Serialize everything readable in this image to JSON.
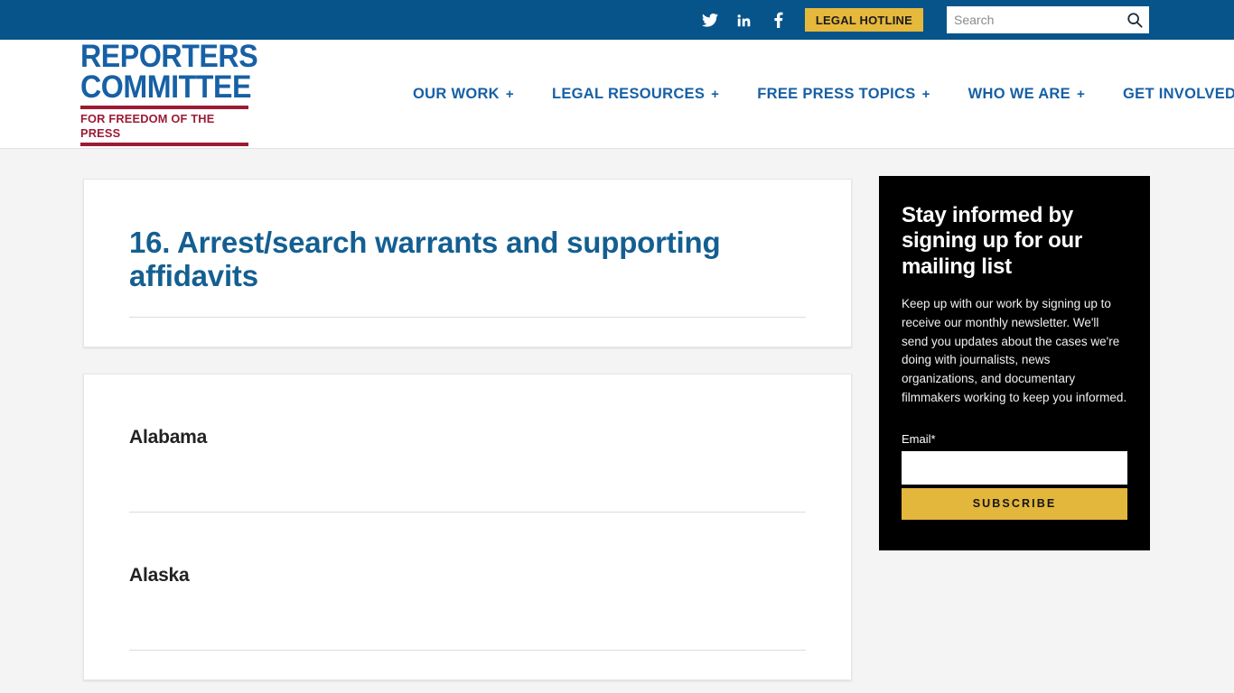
{
  "topbar": {
    "social": [
      {
        "name": "twitter-icon",
        "label": "Twitter"
      },
      {
        "name": "linkedin-icon",
        "label": "LinkedIn"
      },
      {
        "name": "facebook-icon",
        "label": "Facebook"
      }
    ],
    "hotline_label": "LEGAL HOTLINE",
    "search": {
      "placeholder": "Search",
      "value": "",
      "icon": "search-icon"
    },
    "background_color": "#07548a",
    "hotline_color": "#e6b93c"
  },
  "header": {
    "logo": {
      "line1": "REPORTERS",
      "line2": "COMMITTEE",
      "tagline": "FOR FREEDOM OF THE PRESS",
      "blue": "#1760a5",
      "red": "#9b1b34"
    },
    "nav": [
      {
        "label": "OUR WORK",
        "plus": "+"
      },
      {
        "label": "LEGAL RESOURCES",
        "plus": "+"
      },
      {
        "label": "FREE PRESS TOPICS",
        "plus": "+"
      },
      {
        "label": "WHO WE ARE",
        "plus": "+"
      },
      {
        "label": "GET INVOLVED",
        "plus": "+"
      }
    ]
  },
  "main": {
    "page_title": "16. Arrest/search warrants and supporting affidavits",
    "title_color": "#145f91",
    "states": [
      {
        "name": "Alabama"
      },
      {
        "name": "Alaska"
      }
    ]
  },
  "sidebar": {
    "title": "Stay informed by signing up for our mailing list",
    "description": "Keep up with our work by signing up to receive our monthly newsletter. We'll send you updates about the cases we're doing with journalists, news organizations, and documentary filmmakers working to keep you informed.",
    "email_label": "Email*",
    "email_value": "",
    "email_placeholder": "",
    "subscribe_label": "SUBSCRIBE",
    "background_color": "#000000",
    "button_color": "#e3b63c"
  }
}
